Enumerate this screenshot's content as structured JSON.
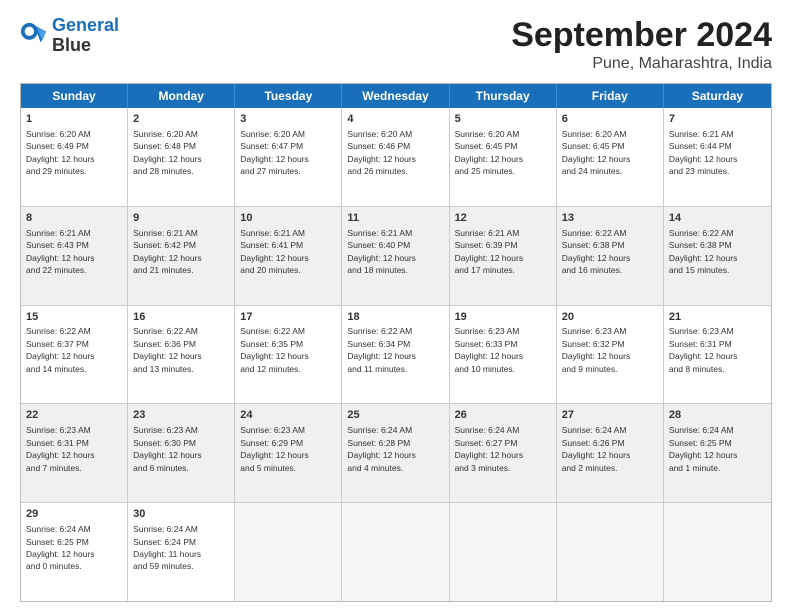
{
  "logo": {
    "line1": "General",
    "line2": "Blue"
  },
  "title": "September 2024",
  "subtitle": "Pune, Maharashtra, India",
  "header_days": [
    "Sunday",
    "Monday",
    "Tuesday",
    "Wednesday",
    "Thursday",
    "Friday",
    "Saturday"
  ],
  "rows": [
    [
      {
        "day": "1",
        "text": "Sunrise: 6:20 AM\nSunset: 6:49 PM\nDaylight: 12 hours\nand 29 minutes.",
        "empty": false,
        "shaded": false
      },
      {
        "day": "2",
        "text": "Sunrise: 6:20 AM\nSunset: 6:48 PM\nDaylight: 12 hours\nand 28 minutes.",
        "empty": false,
        "shaded": false
      },
      {
        "day": "3",
        "text": "Sunrise: 6:20 AM\nSunset: 6:47 PM\nDaylight: 12 hours\nand 27 minutes.",
        "empty": false,
        "shaded": false
      },
      {
        "day": "4",
        "text": "Sunrise: 6:20 AM\nSunset: 6:46 PM\nDaylight: 12 hours\nand 26 minutes.",
        "empty": false,
        "shaded": false
      },
      {
        "day": "5",
        "text": "Sunrise: 6:20 AM\nSunset: 6:45 PM\nDaylight: 12 hours\nand 25 minutes.",
        "empty": false,
        "shaded": false
      },
      {
        "day": "6",
        "text": "Sunrise: 6:20 AM\nSunset: 6:45 PM\nDaylight: 12 hours\nand 24 minutes.",
        "empty": false,
        "shaded": false
      },
      {
        "day": "7",
        "text": "Sunrise: 6:21 AM\nSunset: 6:44 PM\nDaylight: 12 hours\nand 23 minutes.",
        "empty": false,
        "shaded": false
      }
    ],
    [
      {
        "day": "8",
        "text": "Sunrise: 6:21 AM\nSunset: 6:43 PM\nDaylight: 12 hours\nand 22 minutes.",
        "empty": false,
        "shaded": true
      },
      {
        "day": "9",
        "text": "Sunrise: 6:21 AM\nSunset: 6:42 PM\nDaylight: 12 hours\nand 21 minutes.",
        "empty": false,
        "shaded": true
      },
      {
        "day": "10",
        "text": "Sunrise: 6:21 AM\nSunset: 6:41 PM\nDaylight: 12 hours\nand 20 minutes.",
        "empty": false,
        "shaded": true
      },
      {
        "day": "11",
        "text": "Sunrise: 6:21 AM\nSunset: 6:40 PM\nDaylight: 12 hours\nand 18 minutes.",
        "empty": false,
        "shaded": true
      },
      {
        "day": "12",
        "text": "Sunrise: 6:21 AM\nSunset: 6:39 PM\nDaylight: 12 hours\nand 17 minutes.",
        "empty": false,
        "shaded": true
      },
      {
        "day": "13",
        "text": "Sunrise: 6:22 AM\nSunset: 6:38 PM\nDaylight: 12 hours\nand 16 minutes.",
        "empty": false,
        "shaded": true
      },
      {
        "day": "14",
        "text": "Sunrise: 6:22 AM\nSunset: 6:38 PM\nDaylight: 12 hours\nand 15 minutes.",
        "empty": false,
        "shaded": true
      }
    ],
    [
      {
        "day": "15",
        "text": "Sunrise: 6:22 AM\nSunset: 6:37 PM\nDaylight: 12 hours\nand 14 minutes.",
        "empty": false,
        "shaded": false
      },
      {
        "day": "16",
        "text": "Sunrise: 6:22 AM\nSunset: 6:36 PM\nDaylight: 12 hours\nand 13 minutes.",
        "empty": false,
        "shaded": false
      },
      {
        "day": "17",
        "text": "Sunrise: 6:22 AM\nSunset: 6:35 PM\nDaylight: 12 hours\nand 12 minutes.",
        "empty": false,
        "shaded": false
      },
      {
        "day": "18",
        "text": "Sunrise: 6:22 AM\nSunset: 6:34 PM\nDaylight: 12 hours\nand 11 minutes.",
        "empty": false,
        "shaded": false
      },
      {
        "day": "19",
        "text": "Sunrise: 6:23 AM\nSunset: 6:33 PM\nDaylight: 12 hours\nand 10 minutes.",
        "empty": false,
        "shaded": false
      },
      {
        "day": "20",
        "text": "Sunrise: 6:23 AM\nSunset: 6:32 PM\nDaylight: 12 hours\nand 9 minutes.",
        "empty": false,
        "shaded": false
      },
      {
        "day": "21",
        "text": "Sunrise: 6:23 AM\nSunset: 6:31 PM\nDaylight: 12 hours\nand 8 minutes.",
        "empty": false,
        "shaded": false
      }
    ],
    [
      {
        "day": "22",
        "text": "Sunrise: 6:23 AM\nSunset: 6:31 PM\nDaylight: 12 hours\nand 7 minutes.",
        "empty": false,
        "shaded": true
      },
      {
        "day": "23",
        "text": "Sunrise: 6:23 AM\nSunset: 6:30 PM\nDaylight: 12 hours\nand 6 minutes.",
        "empty": false,
        "shaded": true
      },
      {
        "day": "24",
        "text": "Sunrise: 6:23 AM\nSunset: 6:29 PM\nDaylight: 12 hours\nand 5 minutes.",
        "empty": false,
        "shaded": true
      },
      {
        "day": "25",
        "text": "Sunrise: 6:24 AM\nSunset: 6:28 PM\nDaylight: 12 hours\nand 4 minutes.",
        "empty": false,
        "shaded": true
      },
      {
        "day": "26",
        "text": "Sunrise: 6:24 AM\nSunset: 6:27 PM\nDaylight: 12 hours\nand 3 minutes.",
        "empty": false,
        "shaded": true
      },
      {
        "day": "27",
        "text": "Sunrise: 6:24 AM\nSunset: 6:26 PM\nDaylight: 12 hours\nand 2 minutes.",
        "empty": false,
        "shaded": true
      },
      {
        "day": "28",
        "text": "Sunrise: 6:24 AM\nSunset: 6:25 PM\nDaylight: 12 hours\nand 1 minute.",
        "empty": false,
        "shaded": true
      }
    ],
    [
      {
        "day": "29",
        "text": "Sunrise: 6:24 AM\nSunset: 6:25 PM\nDaylight: 12 hours\nand 0 minutes.",
        "empty": false,
        "shaded": false
      },
      {
        "day": "30",
        "text": "Sunrise: 6:24 AM\nSunset: 6:24 PM\nDaylight: 11 hours\nand 59 minutes.",
        "empty": false,
        "shaded": false
      },
      {
        "day": "",
        "text": "",
        "empty": true,
        "shaded": false
      },
      {
        "day": "",
        "text": "",
        "empty": true,
        "shaded": false
      },
      {
        "day": "",
        "text": "",
        "empty": true,
        "shaded": false
      },
      {
        "day": "",
        "text": "",
        "empty": true,
        "shaded": false
      },
      {
        "day": "",
        "text": "",
        "empty": true,
        "shaded": false
      }
    ]
  ]
}
